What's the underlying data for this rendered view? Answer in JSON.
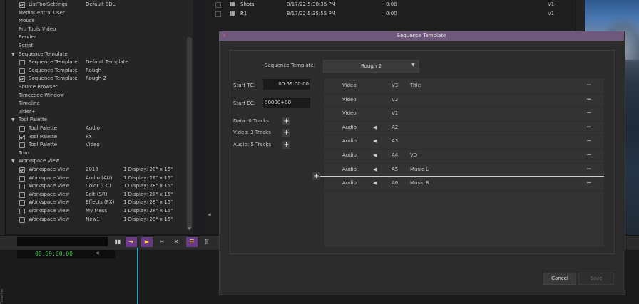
{
  "settings": {
    "rows": [
      {
        "kind": "item",
        "checkbox": "checked",
        "name": "ListToolSettings",
        "c2": "Default EDL",
        "c3": ""
      },
      {
        "kind": "plain",
        "name": "MediaCentral User"
      },
      {
        "kind": "plain",
        "name": "Mouse"
      },
      {
        "kind": "plain",
        "name": "Pro Tools Video"
      },
      {
        "kind": "plain",
        "name": "Render"
      },
      {
        "kind": "plain",
        "name": "Script"
      },
      {
        "kind": "group",
        "name": "Sequence Template"
      },
      {
        "kind": "item",
        "checkbox": "unchecked",
        "name": "Sequence Template",
        "c2": "Default Template",
        "c3": ""
      },
      {
        "kind": "item",
        "checkbox": "unchecked",
        "name": "Sequence Template",
        "c2": "Rough",
        "c3": ""
      },
      {
        "kind": "item",
        "checkbox": "checked",
        "name": "Sequence Template",
        "c2": "Rough 2",
        "c3": ""
      },
      {
        "kind": "plain",
        "name": "Source Browser"
      },
      {
        "kind": "plain",
        "name": "Timecode Window"
      },
      {
        "kind": "plain",
        "name": "Timeline"
      },
      {
        "kind": "plain",
        "name": "Titler+"
      },
      {
        "kind": "group",
        "name": "Tool Palette"
      },
      {
        "kind": "item",
        "checkbox": "unchecked",
        "name": "Tool Palette",
        "c2": "Audio",
        "c3": ""
      },
      {
        "kind": "item",
        "checkbox": "checked",
        "name": "Tool Palette",
        "c2": "FX",
        "c3": ""
      },
      {
        "kind": "item",
        "checkbox": "unchecked",
        "name": "Tool Palette",
        "c2": "Video",
        "c3": ""
      },
      {
        "kind": "plain",
        "name": "Trim"
      },
      {
        "kind": "group",
        "name": "Workspace View"
      },
      {
        "kind": "item",
        "checkbox": "checked",
        "name": "Workspace View",
        "c2": "2018",
        "c3": "1 Display: 28\" x 15\""
      },
      {
        "kind": "item",
        "checkbox": "unchecked",
        "name": "Workspace View",
        "c2": "Audio (AU)",
        "c3": "1 Display: 28\" x 15\""
      },
      {
        "kind": "item",
        "checkbox": "unchecked",
        "name": "Workspace View",
        "c2": "Color (CC)",
        "c3": "1 Display: 28\" x 15\""
      },
      {
        "kind": "item",
        "checkbox": "unchecked",
        "name": "Workspace View",
        "c2": "Edit (SR)",
        "c3": "1 Display: 28\" x 15\""
      },
      {
        "kind": "item",
        "checkbox": "unchecked",
        "name": "Workspace View",
        "c2": "Effects (FX)",
        "c3": "1 Display: 28\" x 15\""
      },
      {
        "kind": "item",
        "checkbox": "unchecked",
        "name": "Workspace View",
        "c2": "My Mess",
        "c3": "1 Display: 28\" x 15\""
      },
      {
        "kind": "item",
        "checkbox": "unchecked",
        "name": "Workspace View",
        "c2": "New1",
        "c3": "1 Display: 28\" x 15\""
      }
    ]
  },
  "bin": {
    "rows": [
      {
        "name": "Shots",
        "date": "8/17/22 5:38:36 PM",
        "duration": "0:00",
        "tracks": "V1-"
      },
      {
        "name": "R1",
        "date": "8/17/22 5:35:55 PM",
        "duration": "0:00",
        "tracks": "V1"
      }
    ]
  },
  "timeline": {
    "timecode": "00:59:00:00",
    "side_label": "Timeline"
  },
  "dialog": {
    "title": "Sequence Template",
    "close_glyph": "×",
    "template_label": "Sequence Template:",
    "template_value": "Rough 2",
    "start_tc_label": "Start TC:",
    "start_tc_value": "00:59:00:00",
    "start_ec_label": "Start EC:",
    "start_ec_value": "00000+00",
    "data_tracks": "Data:  0  Tracks",
    "video_tracks": "Video:  3  Tracks",
    "audio_tracks": "Audio:  5  Tracks",
    "plus_glyph": "+",
    "minus_glyph": "−",
    "tracks": [
      {
        "type": "Video",
        "speaker": false,
        "track": "V3",
        "name": "Title"
      },
      {
        "type": "Video",
        "speaker": false,
        "track": "V2",
        "name": ""
      },
      {
        "type": "Video",
        "speaker": false,
        "track": "V1",
        "name": ""
      },
      {
        "type": "Audio",
        "speaker": true,
        "track": "A2",
        "name": ""
      },
      {
        "type": "Audio",
        "speaker": true,
        "track": "A3",
        "name": ""
      },
      {
        "type": "Audio",
        "speaker": true,
        "track": "A4",
        "name": "VO"
      },
      {
        "type": "Audio",
        "speaker": true,
        "track": "A5",
        "name": "Music L"
      },
      {
        "type": "Audio",
        "speaker": true,
        "track": "A6",
        "name": "Music R"
      }
    ],
    "cancel_label": "Cancel",
    "save_label": "Save"
  },
  "colors": {
    "dialog_title_bar": "#6e587b",
    "timecode_green": "#49c04f",
    "playhead_blue": "#2aa6c9",
    "toolbar_purple": "#6a3a86"
  }
}
